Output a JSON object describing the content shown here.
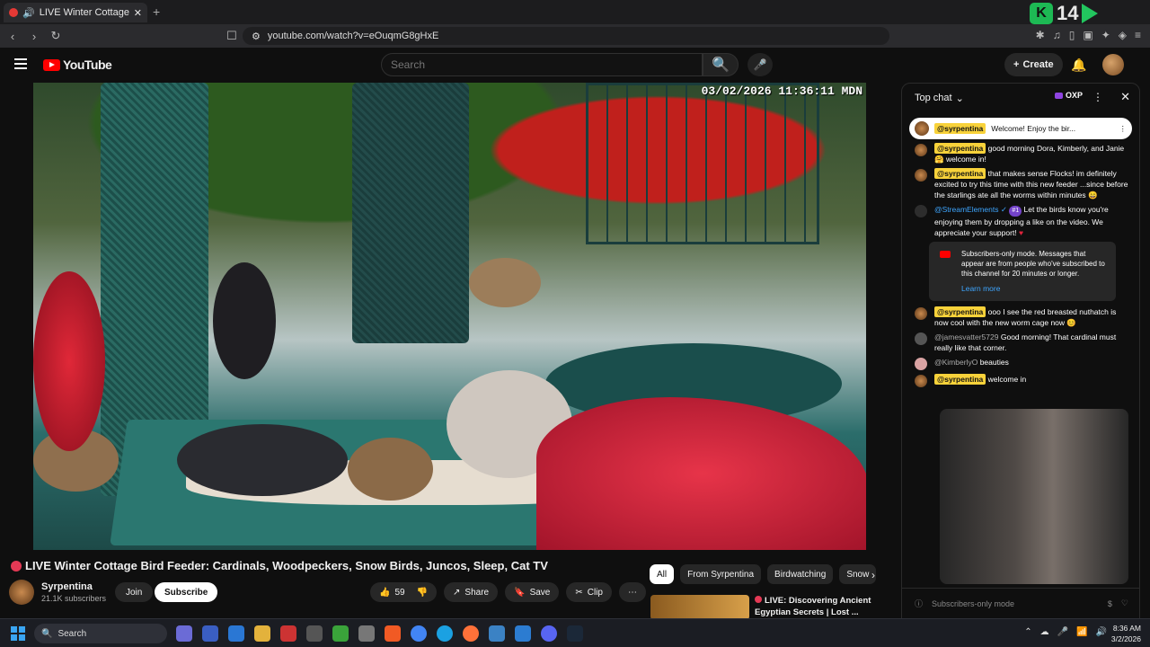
{
  "browser": {
    "tab_title": "LIVE Winter Cottage Bird F",
    "url": "youtube.com/watch?v=eOuqmG8gHxE",
    "counter": "14"
  },
  "youtube": {
    "logo": "YouTube",
    "search_placeholder": "Search",
    "create_label": "Create"
  },
  "video": {
    "timestamp": "03/02/2026 11:36:11 MDN",
    "title": "LIVE Winter Cottage Bird Feeder: Cardinals, Woodpeckers, Snow Birds, Juncos, Sleep, Cat TV",
    "channel": "Syrpentina",
    "subscribers": "21.1K subscribers",
    "join_label": "Join",
    "subscribe_label": "Subscribe",
    "likes": "59",
    "share_label": "Share",
    "save_label": "Save",
    "clip_label": "Clip"
  },
  "chips": [
    "All",
    "From Syrpentina",
    "Birdwatching",
    "Snow"
  ],
  "recommendation": {
    "title": "LIVE: Discovering Ancient Egyptian Secrets | Lost ..."
  },
  "chat": {
    "header": "Top chat",
    "oxp": "OXP",
    "pinned_user": "@syrpentina",
    "pinned_text": "Welcome! Enjoy the bir...",
    "messages": [
      {
        "user": "@syrpentina",
        "text": "good morning Dora, Kimberly, and Janie 🤗 welcome in!"
      },
      {
        "user": "@syrpentina",
        "text": "that makes sense Flocks! im definitely excited to try this time with this new feeder ...since before the starlings ate all the worms within minutes 😄"
      },
      {
        "user": "@StreamElements ✓",
        "badge": "#1",
        "text": "Let the birds know you're enjoying them by dropping a like on the video. We appreciate your support!"
      },
      {
        "user": "@syrpentina",
        "text": "ooo I see the red breasted nuthatch is now cool with the new worm cage now 😊"
      },
      {
        "user": "@jamesvatter5729",
        "text": "Good morning! That cardinal must really like that corner."
      },
      {
        "user": "@KimberlyO",
        "text": "beauties"
      },
      {
        "user": "@syrpentina",
        "text": "welcome in"
      }
    ],
    "notice_text": "Subscribers-only mode. Messages that appear are from people who've subscribed to this channel for 20 minutes or longer.",
    "learn_more": "Learn more",
    "input_placeholder": "Subscribers-only mode"
  },
  "taskbar": {
    "search": "Search",
    "time": "8:36 AM",
    "date": "3/2/2026"
  },
  "colors": {
    "youtube_red": "#ff0000",
    "link_blue": "#3ea6ff",
    "mention_yellow": "#f8d23a"
  }
}
